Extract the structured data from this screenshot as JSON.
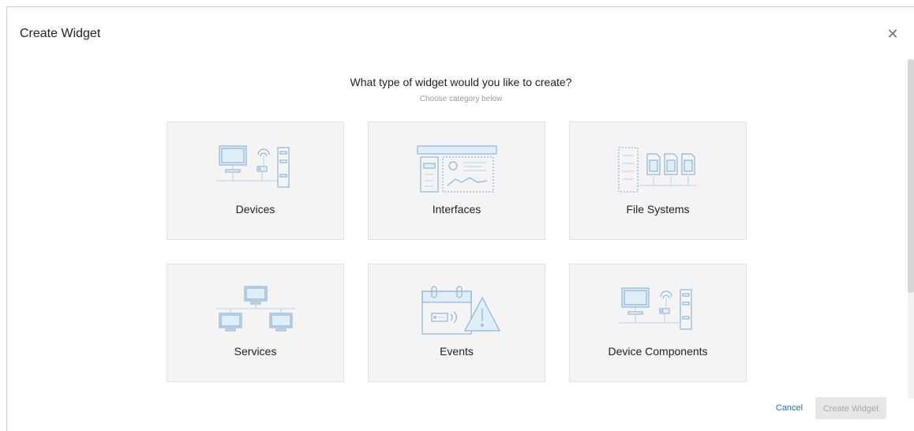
{
  "dialog": {
    "title": "Create Widget",
    "close_icon": "close-icon"
  },
  "main": {
    "question": "What type of widget would you like to create?",
    "hint": "Choose category below"
  },
  "categories": [
    {
      "label": "Devices",
      "icon": "devices-illustration-icon"
    },
    {
      "label": "Interfaces",
      "icon": "interfaces-illustration-icon"
    },
    {
      "label": "File Systems",
      "icon": "file-systems-illustration-icon"
    },
    {
      "label": "Services",
      "icon": "services-illustration-icon"
    },
    {
      "label": "Events",
      "icon": "events-illustration-icon"
    },
    {
      "label": "Device Components",
      "icon": "device-components-illustration-icon"
    }
  ],
  "footer": {
    "cancel_label": "Cancel",
    "create_label": "Create Widget"
  },
  "colors": {
    "accent": "#1e6fbf",
    "card_bg": "#f4f4f4",
    "illustration": "#8fb4d6"
  }
}
